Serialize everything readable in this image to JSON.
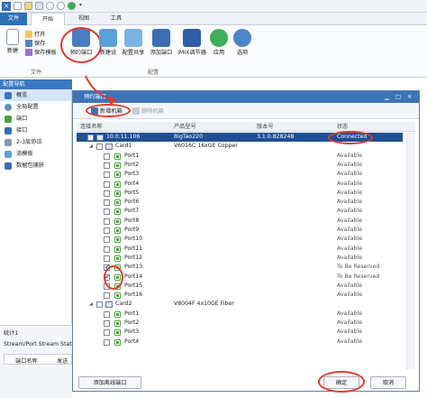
{
  "titlebar": {
    "tab_file": "文件",
    "tab_start": "开始",
    "tab_view": "视图",
    "tab_tools": "工具"
  },
  "ribbon": {
    "new": "新建",
    "open": "打开",
    "save": "保存",
    "save_template": "保存模板",
    "reserve_port": "预约端口",
    "new_device": "新建设",
    "config_share": "配置共享",
    "add_port": "添加端口",
    "imix": "IMIX调节器",
    "apply": "应用",
    "options": "选项",
    "group_file": "文件",
    "group_config": "配置"
  },
  "nav": {
    "header": "配置导航",
    "items": [
      "概览",
      "全局配置",
      "端口",
      "接口",
      "2-3层协议",
      "流模板",
      "数据包捕获"
    ]
  },
  "stats": {
    "title": "统计1",
    "row1": "Stream/Port Stream Stat",
    "col1": "端口名称",
    "col2": "发送"
  },
  "dialog": {
    "title": "预约端口",
    "add_device": "新增机箱",
    "delete_device": "删除机箱",
    "columns": {
      "name": "连接名称",
      "model": "产品型号",
      "version": "版本号",
      "status": "状态"
    },
    "rows": [
      {
        "name": "10.0.11.106",
        "model": "BigTao220",
        "version": "3.1.0.828248",
        "status": "Connected"
      },
      {
        "name": "Card1",
        "model": "V6016C 16xGE Copper",
        "version": "",
        "status": ""
      },
      {
        "name": "Port1",
        "model": "",
        "version": "",
        "status": "Available"
      },
      {
        "name": "Port2",
        "model": "",
        "version": "",
        "status": "Available"
      },
      {
        "name": "Port3",
        "model": "",
        "version": "",
        "status": "Available"
      },
      {
        "name": "Port4",
        "model": "",
        "version": "",
        "status": "Available"
      },
      {
        "name": "Port5",
        "model": "",
        "version": "",
        "status": "Available"
      },
      {
        "name": "Port6",
        "model": "",
        "version": "",
        "status": "Available"
      },
      {
        "name": "Port7",
        "model": "",
        "version": "",
        "status": "Available"
      },
      {
        "name": "Port8",
        "model": "",
        "version": "",
        "status": "Available"
      },
      {
        "name": "Port9",
        "model": "",
        "version": "",
        "status": "Available"
      },
      {
        "name": "Port10",
        "model": "",
        "version": "",
        "status": "Available"
      },
      {
        "name": "Port11",
        "model": "",
        "version": "",
        "status": "Available"
      },
      {
        "name": "Port12",
        "model": "",
        "version": "",
        "status": "Available"
      },
      {
        "name": "Port13",
        "model": "",
        "version": "",
        "status": "To Be Reserved"
      },
      {
        "name": "Port14",
        "model": "",
        "version": "",
        "status": "To Be Reserved"
      },
      {
        "name": "Port15",
        "model": "",
        "version": "",
        "status": "Available"
      },
      {
        "name": "Port16",
        "model": "",
        "version": "",
        "status": "Available"
      },
      {
        "name": "Card2",
        "model": "V8004F 4x10GE Fiber",
        "version": "",
        "status": ""
      },
      {
        "name": "Port1",
        "model": "",
        "version": "",
        "status": "Available"
      },
      {
        "name": "Port2",
        "model": "",
        "version": "",
        "status": "Available"
      },
      {
        "name": "Port3",
        "model": "",
        "version": "",
        "status": "Available"
      },
      {
        "name": "Port4",
        "model": "",
        "version": "",
        "status": "Available"
      }
    ],
    "add_offline": "添加离线端口",
    "ok": "确定",
    "cancel": "取消"
  },
  "colors": {
    "accent": "#3d74b6",
    "selected_row": "#1f4f95",
    "annotation": "#e23b2e",
    "port_icon": "#4ba23a"
  }
}
